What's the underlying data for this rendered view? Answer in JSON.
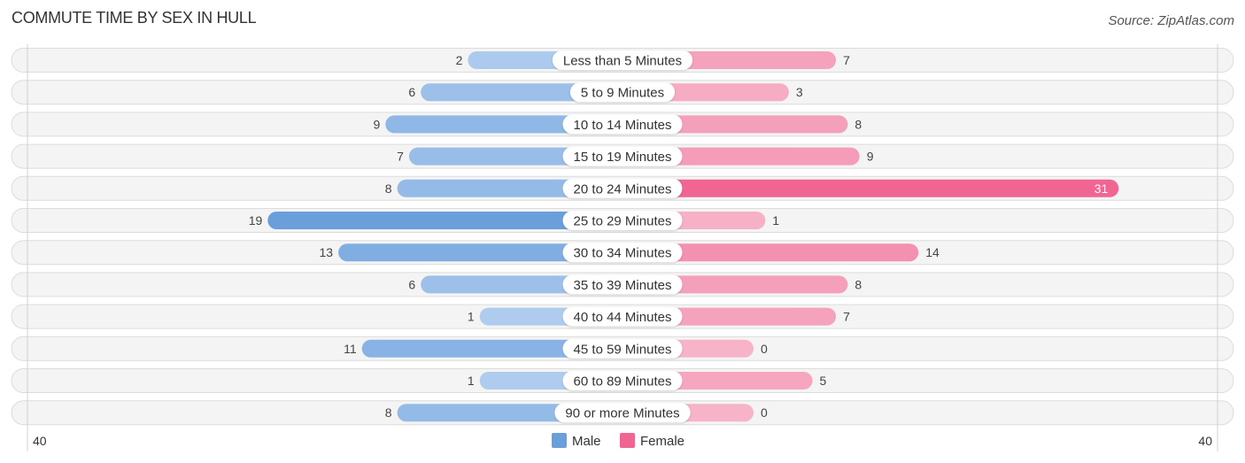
{
  "header": {
    "title": "COMMUTE TIME BY SEX IN HULL",
    "source": "Source: ZipAtlas.com"
  },
  "chart_data": {
    "type": "bar",
    "orientation": "horizontal-diverging",
    "title": "COMMUTE TIME BY SEX IN HULL",
    "categories": [
      "Less than 5 Minutes",
      "5 to 9 Minutes",
      "10 to 14 Minutes",
      "15 to 19 Minutes",
      "20 to 24 Minutes",
      "25 to 29 Minutes",
      "30 to 34 Minutes",
      "35 to 39 Minutes",
      "40 to 44 Minutes",
      "45 to 59 Minutes",
      "60 to 89 Minutes",
      "90 or more Minutes"
    ],
    "series": [
      {
        "name": "Male",
        "color": "#6a9fdb",
        "values": [
          2,
          6,
          9,
          7,
          8,
          19,
          13,
          6,
          1,
          11,
          1,
          8
        ]
      },
      {
        "name": "Female",
        "color": "#f06592",
        "values": [
          7,
          3,
          8,
          9,
          31,
          1,
          14,
          8,
          7,
          0,
          5,
          0
        ]
      }
    ],
    "axis": {
      "left_label": "40",
      "right_label": "40",
      "max": 40
    },
    "legend": {
      "position": "bottom-center",
      "entries": [
        "Male",
        "Female"
      ]
    }
  }
}
